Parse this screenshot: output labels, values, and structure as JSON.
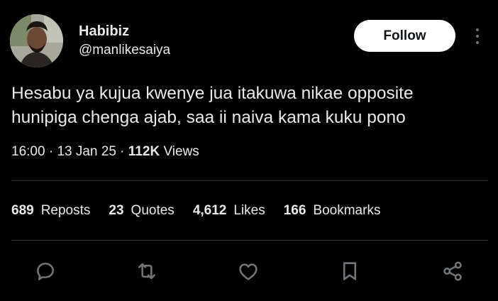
{
  "author": {
    "display_name": "Habibiz",
    "handle": "@manlikesaiya"
  },
  "follow_label": "Follow",
  "tweet": {
    "text_line1": "Hesabu ya kujua kwenye jua itakuwa nikae opposite",
    "text_line2": "hunipiga chenga ajab, saa ii naiva kama kuku pono",
    "time": "16:00",
    "separator": " · ",
    "date": "13 Jan 25",
    "views_count": "112K",
    "views_label": "Views"
  },
  "stats": [
    {
      "count": "689",
      "label": "Reposts"
    },
    {
      "count": "23",
      "label": "Quotes"
    },
    {
      "count": "4,612",
      "label": "Likes"
    },
    {
      "count": "166",
      "label": "Bookmarks"
    }
  ],
  "actions": [
    "reply-icon",
    "repost-icon",
    "like-icon",
    "bookmark-icon",
    "share-icon"
  ],
  "colors": {
    "background": "#000000",
    "text": "#e7e9ea",
    "icon": "#71767b",
    "divider": "#2f3336",
    "follow_bg": "#ffffff"
  }
}
